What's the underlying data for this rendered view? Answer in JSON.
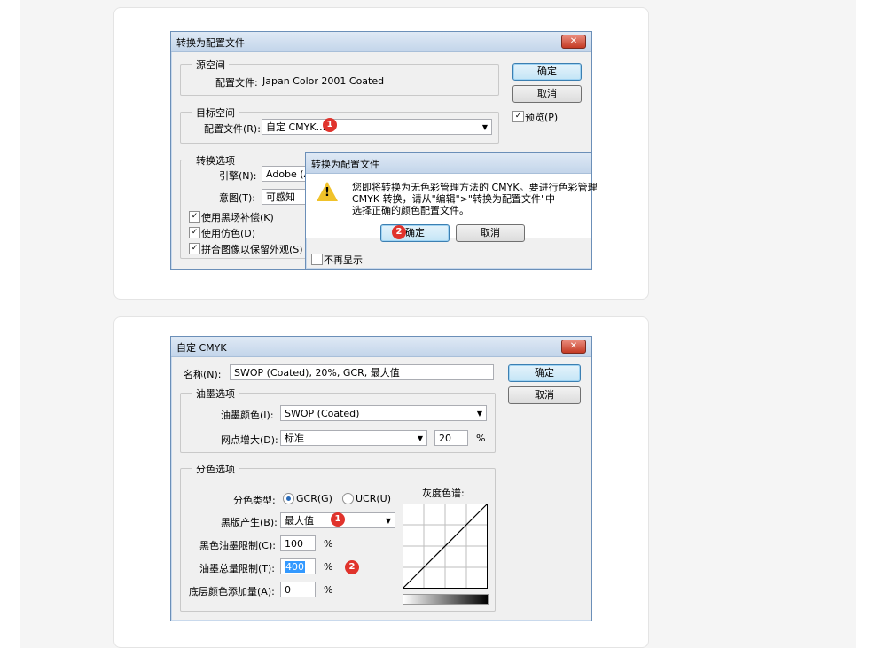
{
  "dialog1": {
    "title": "转换为配置文件",
    "source_space_legend": "源空间",
    "source_profile_label": "配置文件:",
    "source_profile_value": "Japan Color 2001 Coated",
    "target_space_legend": "目标空间",
    "target_profile_label": "配置文件(R):",
    "target_profile_value": "自定 CMYK...",
    "conversion_legend": "转换选项",
    "engine_label": "引擎(N):",
    "engine_value": "Adobe (A",
    "intent_label": "意图(T):",
    "intent_value": "可感知",
    "black_point_label": "使用黑场补偿(K)",
    "dither_label": "使用仿色(D)",
    "flatten_label": "拼合图像以保留外观(S)",
    "ok_label": "确定",
    "cancel_label": "取消",
    "preview_label": "预览(P)",
    "badge1": "1"
  },
  "alert": {
    "title": "转换为配置文件",
    "message_line1": "您即将转换为无色彩管理方法的 CMYK。要进行色彩管理",
    "message_line2": "CMYK 转换，请从\"编辑\">\"转换为配置文件\"中",
    "message_line3": "选择正确的颜色配置文件。",
    "ok_label": "确定",
    "cancel_label": "取消",
    "dont_show_label": "不再显示",
    "badge2": "2"
  },
  "dialog2": {
    "title": "自定 CMYK",
    "name_label": "名称(N):",
    "name_value": "SWOP (Coated), 20%, GCR, 最大值",
    "ok_label": "确定",
    "cancel_label": "取消",
    "ink_legend": "油墨选项",
    "ink_colors_label": "油墨颜色(I):",
    "ink_colors_value": "SWOP (Coated)",
    "dot_gain_label": "网点增大(D):",
    "dot_gain_value": "标准",
    "dot_gain_percent": "20",
    "percent": "%",
    "separation_legend": "分色选项",
    "separation_type_label": "分色类型:",
    "gcr_label": "GCR(G)",
    "ucr_label": "UCR(U)",
    "gray_ramp_label": "灰度色谱:",
    "black_gen_label": "黑版产生(B):",
    "black_gen_value": "最大值",
    "black_ink_limit_label": "黑色油墨限制(C):",
    "black_ink_limit_value": "100",
    "total_ink_limit_label": "油墨总量限制(T):",
    "total_ink_limit_value": "400",
    "ucа_label": "底层颜色添加量(A):",
    "uca_value": "0",
    "badge1": "1",
    "badge2": "2"
  },
  "colors": {
    "badge": "#e0332c",
    "title_gradient_top": "#dfe9f5",
    "close_button": "#c43a24"
  }
}
